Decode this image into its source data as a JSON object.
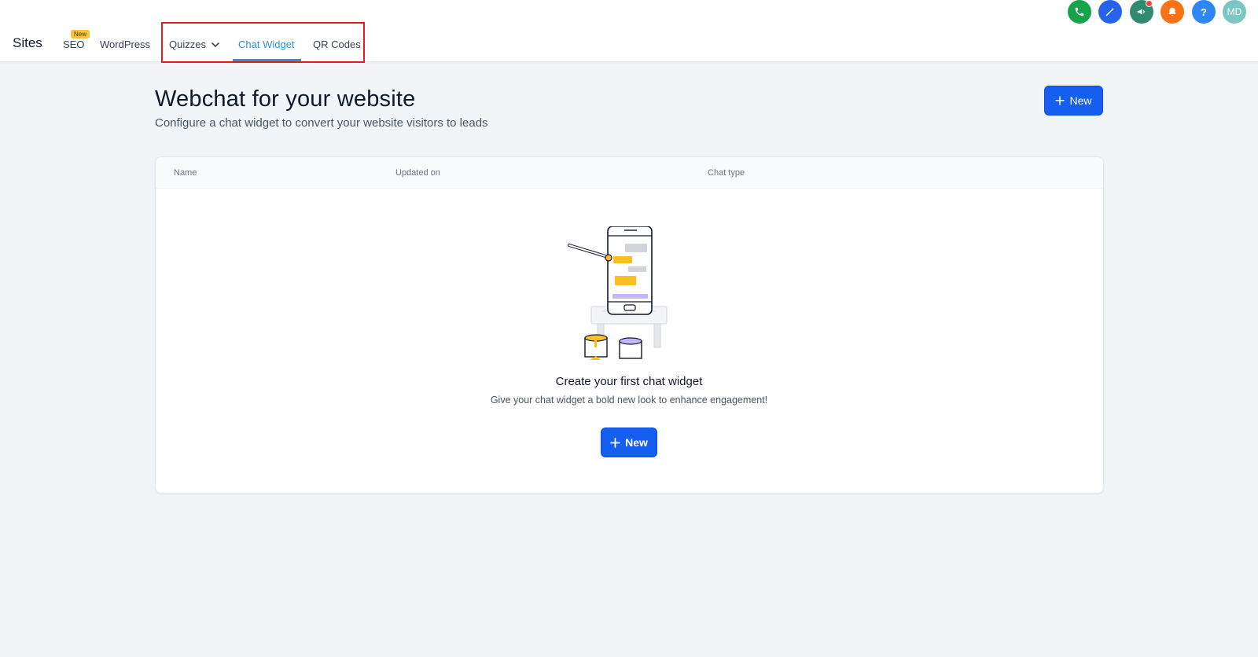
{
  "topbar": {
    "brand": "Sites",
    "nav": {
      "seo": "SEO",
      "seo_badge": "New",
      "wordpress": "WordPress",
      "quizzes": "Quizzes",
      "chat_widget": "Chat Widget",
      "qr_codes": "QR Codes"
    },
    "avatar_initials": "MD",
    "help_label": "?"
  },
  "header": {
    "title": "Webchat for your website",
    "subtitle": "Configure a chat widget to convert your website visitors to leads",
    "new_button": "New"
  },
  "table": {
    "columns": [
      "Name",
      "Updated on",
      "Chat type"
    ]
  },
  "empty_state": {
    "title": "Create your first chat widget",
    "subtitle": "Give your chat widget a bold new look to enhance engagement!",
    "button": "New"
  },
  "colors": {
    "primary": "#155eef",
    "active_tab": "#2b94d4",
    "highlight": "#e11d1d"
  }
}
